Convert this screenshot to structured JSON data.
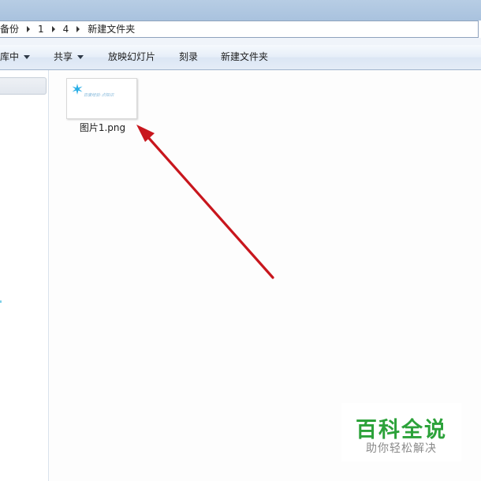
{
  "address_bar": {
    "crumbs": [
      "备份",
      "1",
      "4",
      "新建文件夹"
    ]
  },
  "toolbar": {
    "include_in_library_label": "库中",
    "share_label": "共享",
    "slideshow_label": "放映幻灯片",
    "burn_label": "刻录",
    "new_folder_label": "新建文件夹"
  },
  "files": [
    {
      "name": "图片1.png",
      "thumbnail_text": "百度经验-点知识"
    }
  ],
  "watermark": {
    "main": "百科全说",
    "sub": "助你轻松解决"
  },
  "colors": {
    "annotation_arrow": "#c8161d",
    "watermark_green": "#2ca23a",
    "thumbnail_star": "#29aee6"
  }
}
